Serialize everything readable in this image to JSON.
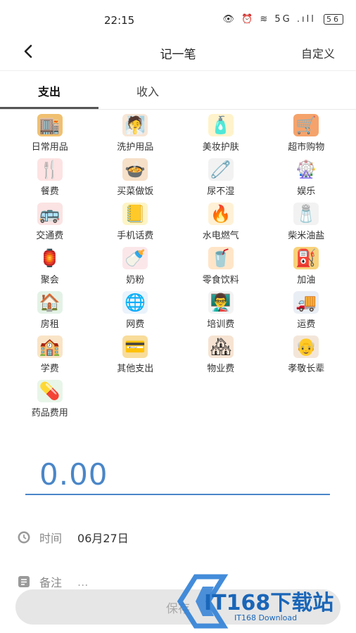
{
  "status_bar": {
    "time": "22:15",
    "indicators": "👁 ⏰ ≋ 5G .ıll",
    "battery": "56"
  },
  "header": {
    "title": "记一笔",
    "custom": "自定义"
  },
  "tabs": [
    {
      "label": "支出"
    },
    {
      "label": "收入"
    }
  ],
  "categories": [
    {
      "label": "日常用品",
      "icon": "🏬",
      "color": "#f0c070"
    },
    {
      "label": "洗护用品",
      "icon": "🧖",
      "color": "#f7e6d6"
    },
    {
      "label": "美妆护肤",
      "icon": "🧴",
      "color": "#fff3cc"
    },
    {
      "label": "超市购物",
      "icon": "🛒",
      "color": "#f5a36b"
    },
    {
      "label": "餐费",
      "icon": "🍴",
      "color": "#fde3e3"
    },
    {
      "label": "买菜做饭",
      "icon": "🍲",
      "color": "#f6e0c8"
    },
    {
      "label": "尿不湿",
      "icon": "🧷",
      "color": "#f2f2f2"
    },
    {
      "label": "娱乐",
      "icon": "🎡",
      "color": "#ffffff"
    },
    {
      "label": "交通费",
      "icon": "🚌",
      "color": "#fbe3e3"
    },
    {
      "label": "手机话费",
      "icon": "📒",
      "color": "#fdf4c6"
    },
    {
      "label": "水电燃气",
      "icon": "🔥",
      "color": "#fff1d6"
    },
    {
      "label": "柴米油盐",
      "icon": "🧂",
      "color": "#f2f2f2"
    },
    {
      "label": "聚会",
      "icon": "🏮",
      "color": "#ffffff"
    },
    {
      "label": "奶粉",
      "icon": "🍼",
      "color": "#fbe7ea"
    },
    {
      "label": "零食饮料",
      "icon": "🥤",
      "color": "#ffe5c8"
    },
    {
      "label": "加油",
      "icon": "⛽",
      "color": "#f8d27a"
    },
    {
      "label": "房租",
      "icon": "🏠",
      "color": "#e3f2e6"
    },
    {
      "label": "网费",
      "icon": "🌐",
      "color": "#eaf3fb"
    },
    {
      "label": "培训费",
      "icon": "👨‍🏫",
      "color": "#f3f3f3"
    },
    {
      "label": "运费",
      "icon": "🚚",
      "color": "#e9eef5"
    },
    {
      "label": "学费",
      "icon": "🏫",
      "color": "#f9e4c7"
    },
    {
      "label": "其他支出",
      "icon": "💳",
      "color": "#f8dc9a"
    },
    {
      "label": "物业费",
      "icon": "🏘",
      "color": "#f6e3d2"
    },
    {
      "label": "孝敬长辈",
      "icon": "👴",
      "color": "#f3e6d9"
    },
    {
      "label": "药品费用",
      "icon": "💊",
      "color": "#e8f6e9"
    }
  ],
  "amount": "0.00",
  "time_row": {
    "key": "时间",
    "value": "06月27日"
  },
  "note_row": {
    "key": "备注",
    "placeholder": "..."
  },
  "save_button": {
    "label": "保存"
  },
  "watermark": {
    "brand": "IT168下载站",
    "sub": "IT168 Download"
  },
  "colors": {
    "accent": "#4a86c8",
    "tab_indicator": "#555555"
  }
}
